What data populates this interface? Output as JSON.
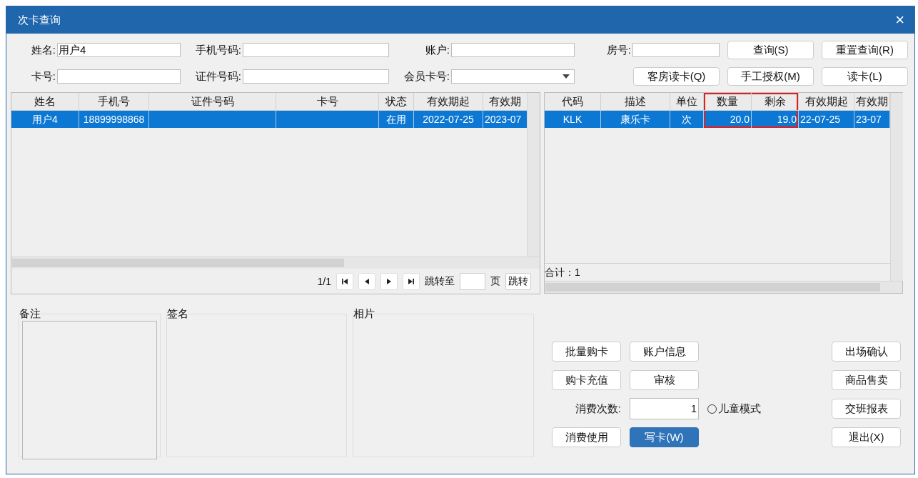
{
  "window": {
    "title": "次卡查询",
    "close": "×"
  },
  "search_rows": [
    {
      "fields": [
        {
          "label": "姓名:",
          "value": "用户4",
          "kind": "text"
        },
        {
          "label": "手机号码:",
          "kind": "text"
        },
        {
          "label": "账户:",
          "kind": "text"
        },
        {
          "label": "房号:",
          "kind": "text"
        }
      ],
      "buttons": [
        "查询(S)",
        "重置查询(R)"
      ]
    },
    {
      "fields": [
        {
          "label": "卡号:",
          "kind": "text"
        },
        {
          "label": "证件号码:",
          "kind": "text"
        },
        {
          "label": "会员卡号:",
          "kind": "dropdown"
        }
      ],
      "buttons": [
        "客房读卡(Q)",
        "手工授权(M)",
        "读卡(L)"
      ]
    }
  ],
  "left_table": {
    "columns": [
      "姓名",
      "手机号",
      "证件号码",
      "卡号",
      "状态",
      "有效期起",
      "有效期"
    ],
    "rows": [
      {
        "cells": [
          "用户4",
          "18899998868",
          "",
          "",
          "在用",
          "2022-07-25",
          "2023-07"
        ],
        "selected": true
      }
    ],
    "pager": {
      "page": "1/1",
      "goto_label": "跳转至",
      "page_unit": "页",
      "goto_button": "跳转"
    }
  },
  "right_table": {
    "columns": [
      {
        "label": "代码",
        "highlighted": false
      },
      {
        "label": "描述",
        "highlighted": false
      },
      {
        "label": "单位",
        "highlighted": false
      },
      {
        "label": "数量",
        "highlighted": true
      },
      {
        "label": "剩余",
        "highlighted": true
      },
      {
        "label": "有效期起",
        "highlighted": false
      },
      {
        "label": "有效期",
        "highlighted": false
      }
    ],
    "rows": [
      {
        "cells": [
          "KLK",
          "康乐卡",
          "次",
          "20.0",
          "19.0",
          "22-07-25",
          "23-07"
        ],
        "selected": true
      }
    ],
    "total": "合计：1"
  },
  "groups": [
    {
      "title": "备注",
      "kind": "textbox"
    },
    {
      "title": "签名",
      "kind": "plain"
    },
    {
      "title": "相片",
      "kind": "plain"
    }
  ],
  "action_rows": [
    {
      "left": [
        {
          "label": "批量购卡",
          "focused": false
        },
        {
          "label": "账户信息",
          "focused": false
        }
      ],
      "right": {
        "label": "出场确认",
        "focused": false
      }
    },
    {
      "left": [
        {
          "label": "购卡充值",
          "focused": false
        },
        {
          "label": "审核",
          "focused": false
        }
      ],
      "right": {
        "label": "商品售卖",
        "focused": false
      }
    },
    {
      "count": {
        "label": "消费次数:",
        "value": "1"
      },
      "radio": {
        "label": "儿童模式",
        "selected": false
      },
      "right": {
        "label": "交班报表",
        "focused": false
      }
    },
    {
      "left": [
        {
          "label": "消费使用",
          "focused": false
        },
        {
          "label": "写卡(W)",
          "focused": true
        }
      ],
      "right": {
        "label": "退出(X)",
        "focused": false
      }
    }
  ]
}
